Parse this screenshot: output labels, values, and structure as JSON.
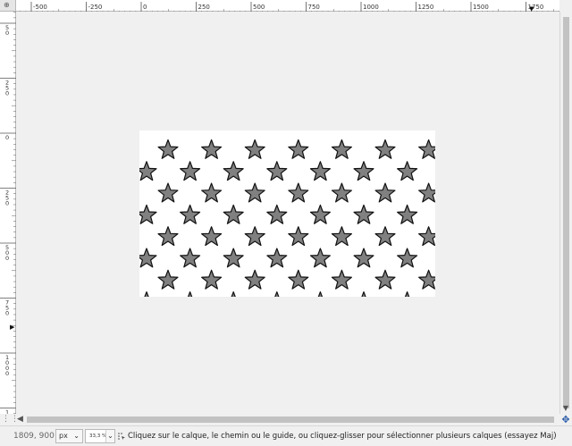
{
  "ruler_corner_glyph": "⊕",
  "horizontal_ruler": {
    "labels": [
      "-500",
      "-250",
      "0",
      "250",
      "500",
      "750",
      "1000",
      "1250",
      "1500",
      "1750"
    ],
    "marker_glyph": "▼"
  },
  "vertical_ruler": {
    "labels": [
      "5\n0",
      "2\n5\n0",
      "0",
      "2\n5\n0",
      "5\n0\n0",
      "7\n5\n0",
      "1\n0\n0\n0",
      "1\n2\n5\n0"
    ],
    "marker_glyph": "▶"
  },
  "canvas": {
    "background_color": "#ffffff",
    "pattern": "stars",
    "star_fill": "#808080",
    "star_stroke": "#111111"
  },
  "scrollbars": {
    "left_arrow": "◀",
    "down_arrow": "▼"
  },
  "quick_mask_glyph": "⋮⋮",
  "navigate_glyph": "✥",
  "status": {
    "coordinates": "1809, 900",
    "unit": "px",
    "zoom": "33,3 %",
    "message": "Cliquez sur le calque, le chemin ou le guide, ou cliquez-glisser pour sélectionner plusieurs calques (essayez Maj)"
  }
}
